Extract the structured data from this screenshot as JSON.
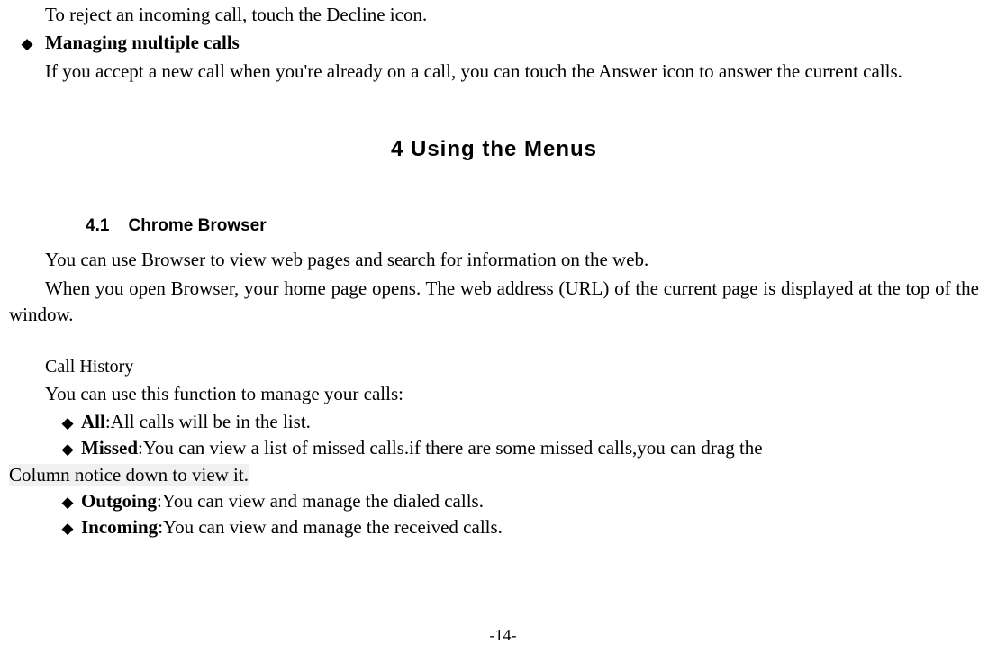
{
  "intro": {
    "reject_line": "To reject an incoming call, touch the Decline icon.",
    "managing_heading": "Managing multiple calls",
    "managing_body": "If you accept a new call when you're already on a call, you can touch the Answer icon to answer the current calls."
  },
  "section": {
    "title": "4 Using the Menus",
    "sub_number": "4.1",
    "sub_title": "Chrome Browser",
    "browser_line1": "You can use Browser to view web pages and search for information on the web.",
    "browser_line2": "When you open Browser, your home page opens. The web address (URL) of the current page is displayed at the top of the window."
  },
  "call_history": {
    "heading": "Call History",
    "intro": "You can use this function to manage your calls:",
    "items": [
      {
        "label": "All",
        "text": ":All calls will be in the list."
      },
      {
        "label": "Missed",
        "text": ":You can view a list of missed calls.if there are some missed calls,you can drag the ",
        "wrap": "Column notice down to view it."
      },
      {
        "label": "Outgoing",
        "text": ":You can view and manage the dialed calls."
      },
      {
        "label": "Incoming",
        "text": ":You can view and manage the received calls."
      }
    ]
  },
  "footer": "-14-",
  "glyphs": {
    "diamond": "◆"
  }
}
